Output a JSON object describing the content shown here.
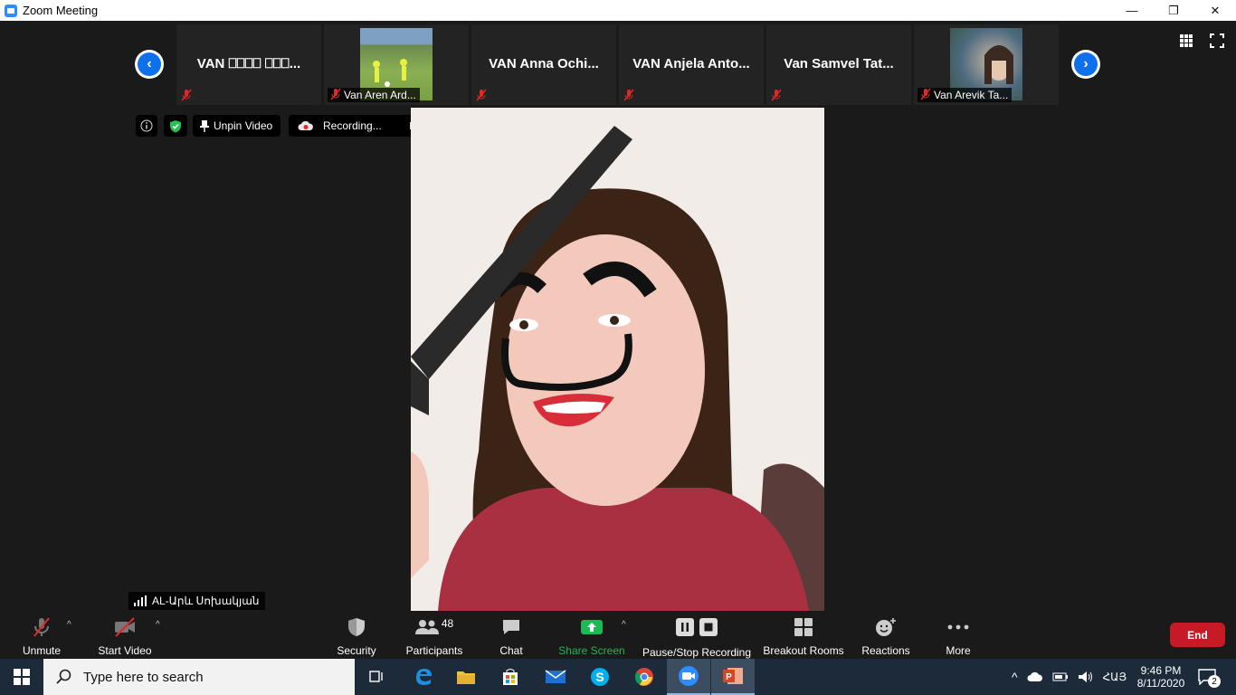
{
  "window": {
    "title": "Zoom Meeting",
    "minimize": "—",
    "restore": "❐",
    "close": "✕"
  },
  "participants": [
    {
      "name": "VAN ⎕⎕⎕⎕ ⎕⎕⎕...",
      "label": "",
      "video": false
    },
    {
      "name": "",
      "label": "Van Aren Ard...",
      "video": true
    },
    {
      "name": "VAN Anna Ochi...",
      "label": "",
      "video": false
    },
    {
      "name": "VAN Anjela Anto...",
      "label": "",
      "video": false
    },
    {
      "name": "Van Samvel Tat...",
      "label": "",
      "video": false
    },
    {
      "name": "",
      "label": "Van Arevik Ta...",
      "video": true
    }
  ],
  "nav": {
    "prev": "‹",
    "next": "›"
  },
  "info_bar": {
    "unpin_label": "Unpin Video",
    "recording_label": "Recording..."
  },
  "active_speaker": {
    "name": "AL-Արև Սոխակյան"
  },
  "toolbar": {
    "unmute": "Unmute",
    "start_video": "Start Video",
    "security": "Security",
    "participants": "Participants",
    "participants_count": "48",
    "chat": "Chat",
    "share_screen": "Share Screen",
    "pause_stop_recording": "Pause/Stop Recording",
    "breakout_rooms": "Breakout Rooms",
    "reactions": "Reactions",
    "more": "More",
    "end": "End"
  },
  "taskbar": {
    "search_placeholder": "Type here to search",
    "time": "9:46 PM",
    "date": "8/11/2020",
    "language": "ՀԱՅ",
    "notifications": "2"
  },
  "colors": {
    "accent": "#0e71eb",
    "end": "#c61b27",
    "share": "#1db954",
    "taskbar": "#1c2a3a"
  }
}
